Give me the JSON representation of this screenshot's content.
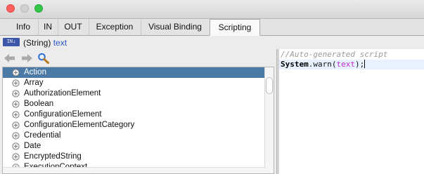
{
  "window": {
    "buttons": [
      "close",
      "minimize",
      "maximize"
    ]
  },
  "tabs": [
    {
      "label": "Info",
      "active": false
    },
    {
      "label": "IN",
      "active": false
    },
    {
      "label": "OUT",
      "active": false
    },
    {
      "label": "Exception",
      "active": false
    },
    {
      "label": "Visual Binding",
      "active": false
    },
    {
      "label": "Scripting",
      "active": true
    }
  ],
  "parameter": {
    "badge": "IN",
    "type": "(String)",
    "name": "text"
  },
  "toolbar": {
    "icons": [
      "back-arrow-icon",
      "forward-arrow-icon",
      "search-icon"
    ]
  },
  "type_list": {
    "selected_index": 0,
    "items": [
      "Action",
      "Array",
      "AuthorizationElement",
      "Boolean",
      "ConfigurationElement",
      "ConfigurationElementCategory",
      "Credential",
      "Date",
      "EncryptedString",
      "ExecutionContext"
    ]
  },
  "editor": {
    "comment": "//Auto-generated script",
    "code_object": "System",
    "code_method": ".warn(",
    "code_arg": "text",
    "code_end": ");"
  },
  "colors": {
    "selection": "#4b7aa6",
    "param_name": "#2a56c6",
    "code_variable": "#c02bd1",
    "comment": "#9b9b9b"
  }
}
